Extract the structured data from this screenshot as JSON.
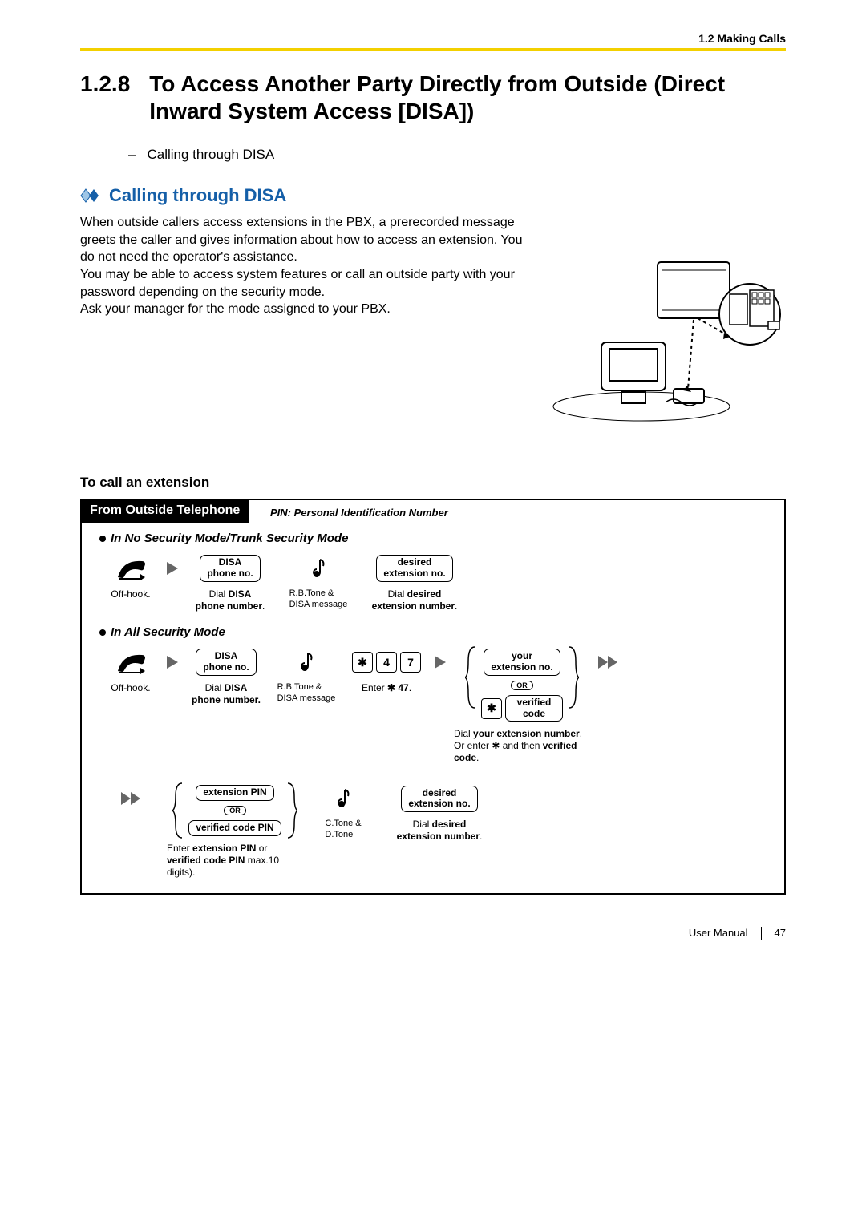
{
  "header": {
    "section": "1.2 Making Calls"
  },
  "title": {
    "number": "1.2.8",
    "text": "To Access Another Party Directly from Outside (Direct Inward System Access [DISA])"
  },
  "toc_item": "Calling through DISA",
  "subheading": "Calling through DISA",
  "paragraph1": "When outside callers access extensions in the PBX, a prerecorded message greets the caller and gives information about how to access an extension. You do not need the operator's assistance.",
  "paragraph2": "You may be able to access system features or call an outside party with your password depending on the security mode.",
  "paragraph3": "Ask your manager for the mode assigned to your PBX.",
  "section_sub": "To call an extension",
  "flow": {
    "tab": "From Outside Telephone",
    "pin_note": "PIN: Personal Identification Number",
    "mode1": {
      "label": "In No Security Mode/Trunk Security Mode",
      "offhook": "Off-hook.",
      "disa_box1": "DISA",
      "disa_box2": "phone no.",
      "dial_disa1": "Dial ",
      "dial_disa2": "DISA",
      "dial_disa3": "phone number",
      "tone1": "R.B.Tone &",
      "tone2": "DISA message",
      "ext_box1": "desired",
      "ext_box2": "extension no.",
      "dial_ext1": "Dial ",
      "dial_ext2": "desired",
      "dial_ext3": "extension number"
    },
    "mode2": {
      "label": "In All Security Mode",
      "offhook": "Off-hook.",
      "disa_box1": "DISA",
      "disa_box2": "phone no.",
      "dial_disa1": "Dial ",
      "dial_disa2": "DISA",
      "dial_disa3": "phone number.",
      "tone1": "R.B.Tone &",
      "tone2": "DISA message",
      "key_star": "✱",
      "key_4": "4",
      "key_7": "7",
      "enter47a": "Enter ",
      "enter47b": "✱ 47",
      "your_ext1": "your",
      "your_ext2": "extension no.",
      "or": "OR",
      "ver_code1": "verified",
      "ver_code2": "code",
      "cap_yext1": "Dial ",
      "cap_yext2": "your extension number",
      "cap_yext3": "Or enter ✱ and then ",
      "cap_yext4": "verified code",
      "ext_pin": "extension PIN",
      "vc_pin": "verified code PIN",
      "tone3": "C.Tone &",
      "tone4": "D.Tone",
      "pin_cap1": "Enter ",
      "pin_cap2": "extension PIN",
      "pin_cap3": " or",
      "pin_cap4": "verified code PIN",
      "pin_cap5": " max.10 digits).",
      "dext_box1": "desired",
      "dext_box2": "extension no.",
      "dext_cap1": "Dial ",
      "dext_cap2": "desired",
      "dext_cap3": "extension number"
    }
  },
  "footer": {
    "label": "User Manual",
    "page": "47"
  }
}
